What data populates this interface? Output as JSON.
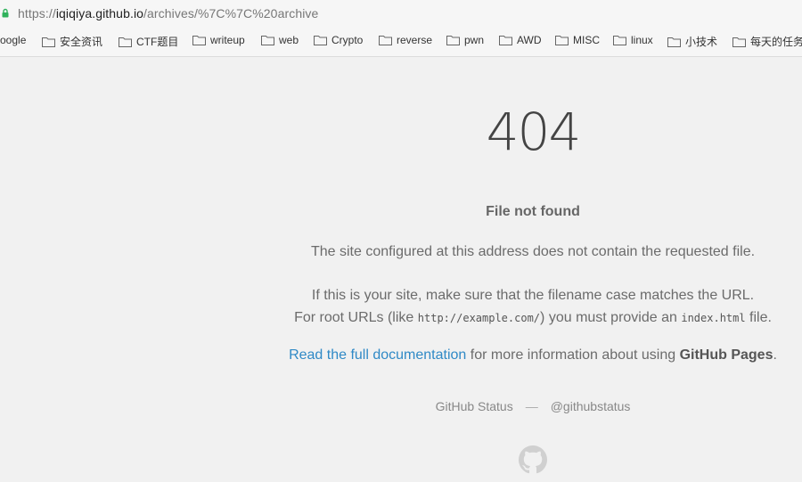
{
  "browser": {
    "url_scheme": "https://",
    "url_host": "iqiqiya.github.io",
    "url_path": "/archives/%7C%7C%20archive"
  },
  "bookmarks": [
    {
      "label": "oogle",
      "folder": false
    },
    {
      "label": "安全资讯",
      "folder": true
    },
    {
      "label": "CTF题目",
      "folder": true
    },
    {
      "label": "writeup",
      "folder": true
    },
    {
      "label": "web",
      "folder": true
    },
    {
      "label": "Crypto",
      "folder": true
    },
    {
      "label": "reverse",
      "folder": true
    },
    {
      "label": "pwn",
      "folder": true
    },
    {
      "label": "AWD",
      "folder": true
    },
    {
      "label": "MISC",
      "folder": true
    },
    {
      "label": "linux",
      "folder": true
    },
    {
      "label": "小技术",
      "folder": true
    },
    {
      "label": "每天的任务",
      "folder": true
    }
  ],
  "page": {
    "code": "404",
    "title": "File not found",
    "p1": "The site configured at this address does not contain the requested file.",
    "p2_line1": "If this is your site, make sure that the filename case matches the URL.",
    "p2_line2_a": "For root URLs (like ",
    "p2_line2_code1": "http://example.com/",
    "p2_line2_b": ") you must provide an ",
    "p2_line2_code2": "index.html",
    "p2_line2_c": " file.",
    "p3_link": "Read the full documentation",
    "p3_text": " for more information about using ",
    "p3_strong": "GitHub Pages",
    "p3_end": ".",
    "footer_status": "GitHub Status",
    "footer_sep": "—",
    "footer_twitter": "@githubstatus"
  },
  "colors": {
    "background": "#f1f1f1",
    "link": "#2f89c6",
    "lock": "#2fb15b"
  }
}
